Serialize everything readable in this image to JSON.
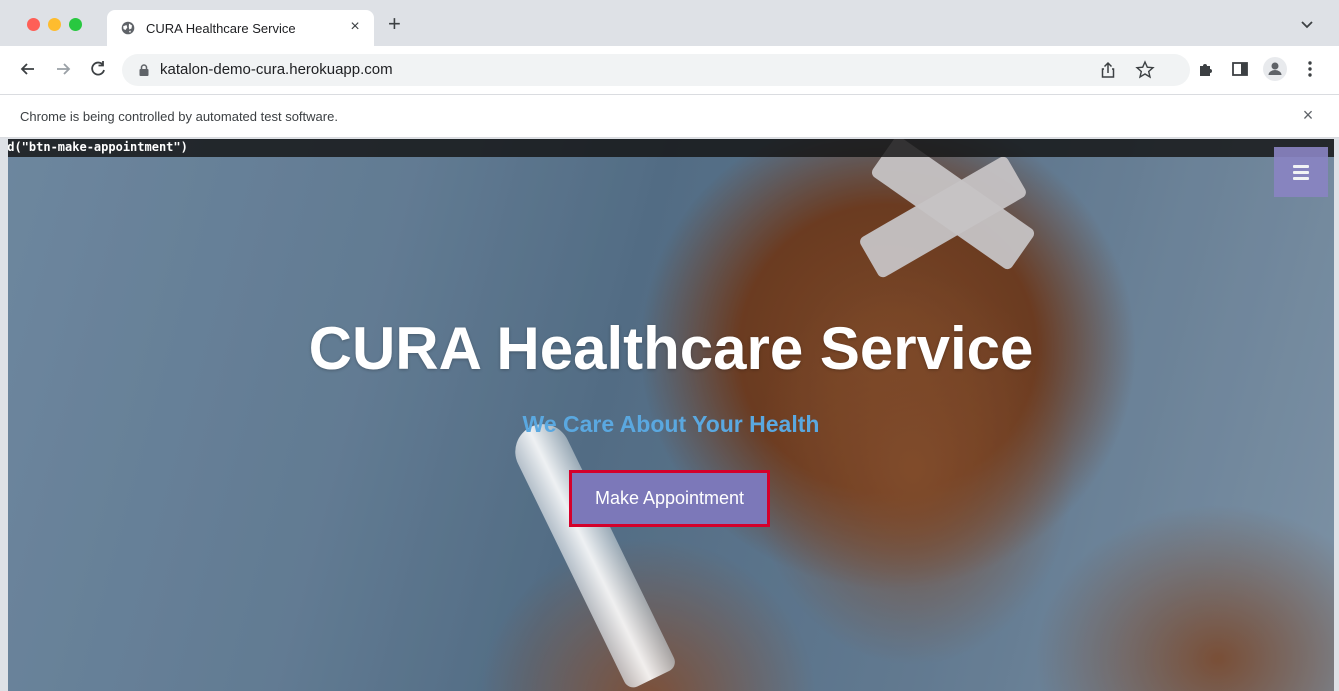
{
  "browser": {
    "tab": {
      "title": "CURA Healthcare Service",
      "favicon": "globe-icon",
      "close_glyph": "×"
    },
    "new_tab_glyph": "+",
    "address": {
      "url": "katalon-demo-cura.herokuapp.com"
    },
    "infobar": {
      "message": "Chrome is being controlled by automated test software.",
      "close_glyph": "×"
    }
  },
  "page": {
    "xpath_overlay": "id(\"btn-make-appointment\")",
    "hero": {
      "title": "CURA Healthcare Service",
      "subtitle": "We Care About Your Health",
      "cta_label": "Make Appointment"
    },
    "menu_icon": "hamburger-icon"
  },
  "colors": {
    "accent": "#7c78b9",
    "highlight_border": "#d4002b",
    "subtitle": "#5aa8e0"
  }
}
